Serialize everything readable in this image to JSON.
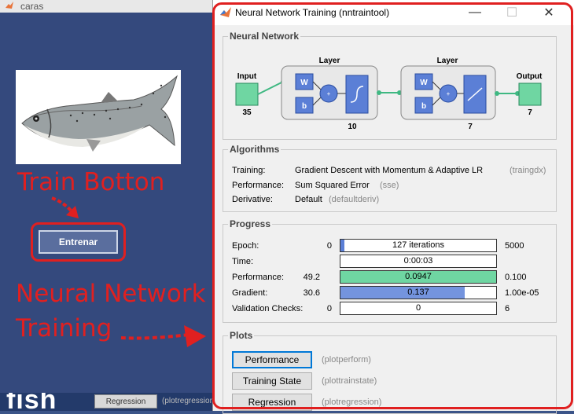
{
  "left_app": {
    "title": "caras",
    "entrenar_label": "Entrenar",
    "annotation_train": "Train Botton",
    "annotation_nn_line1": "Neural Network",
    "annotation_nn_line2": "Training",
    "bg_regression_button": "Regression",
    "bg_regression_fn": "(plotregression)"
  },
  "window": {
    "title": "Neural Network Training (nntraintool)",
    "minimize": "—",
    "maximize": "☐",
    "close": "✕"
  },
  "network": {
    "section_title": "Neural Network",
    "input_label": "Input",
    "input_size": "35",
    "layer1_label": "Layer",
    "layer1_size": "10",
    "layer2_label": "Layer",
    "layer2_size": "7",
    "output_label": "Output",
    "output_size": "7",
    "weight_label": "W",
    "bias_label": "b",
    "sum_label": "+"
  },
  "algorithms": {
    "section_title": "Algorithms",
    "rows": [
      {
        "label": "Training:",
        "value": "Gradient Descent with Momentum & Adaptive LR",
        "fn": "(traingdx)"
      },
      {
        "label": "Performance:",
        "value": "Sum Squared Error",
        "fn": "(sse)"
      },
      {
        "label": "Derivative:",
        "value": "Default",
        "fn": "(defaultderiv)"
      }
    ]
  },
  "progress": {
    "section_title": "Progress",
    "rows": [
      {
        "label": "Epoch:",
        "min": "0",
        "text": "127 iterations",
        "max": "5000",
        "fraction": 0.025,
        "color": "#5b7fd6"
      },
      {
        "label": "Time:",
        "min": "",
        "text": "0:00:03",
        "max": "",
        "fraction": 0,
        "color": "#5b7fd6"
      },
      {
        "label": "Performance:",
        "min": "49.2",
        "text": "0.0947",
        "max": "0.100",
        "fraction": 1.0,
        "color": "#6fd6a2"
      },
      {
        "label": "Gradient:",
        "min": "30.6",
        "text": "0.137",
        "max": "1.00e-05",
        "fraction": 0.8,
        "color": "#7494de"
      },
      {
        "label": "Validation Checks:",
        "min": "0",
        "text": "0",
        "max": "6",
        "fraction": 0,
        "color": "#5b7fd6"
      }
    ]
  },
  "plots": {
    "section_title": "Plots",
    "buttons": [
      {
        "label": "Performance",
        "fn": "(plotperform)"
      },
      {
        "label": "Training State",
        "fn": "(plottrainstate)"
      },
      {
        "label": "Regression",
        "fn": "(plotregression)"
      }
    ]
  },
  "colors": {
    "annotation_red": "#e02020",
    "input_green": "#6fd6a2",
    "layer_blue": "#5b7fd6"
  }
}
